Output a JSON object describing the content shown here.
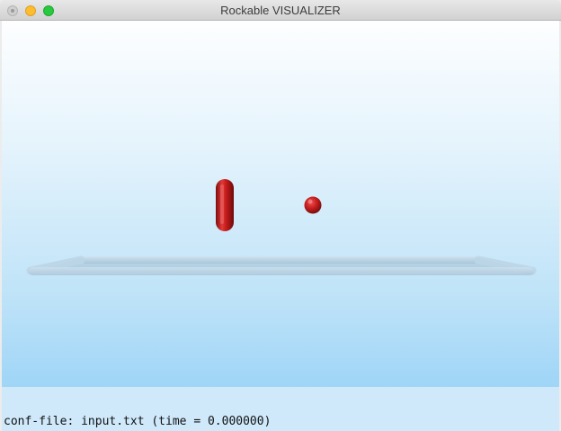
{
  "window": {
    "title": "Rockable VISUALIZER"
  },
  "scene": {
    "capsule_color": "#cc1f1f",
    "sphere_color": "#cc1f1f",
    "floor_color": "#a9c7da"
  },
  "status": {
    "text": "conf-file: input.txt (time = 0.000000)"
  }
}
